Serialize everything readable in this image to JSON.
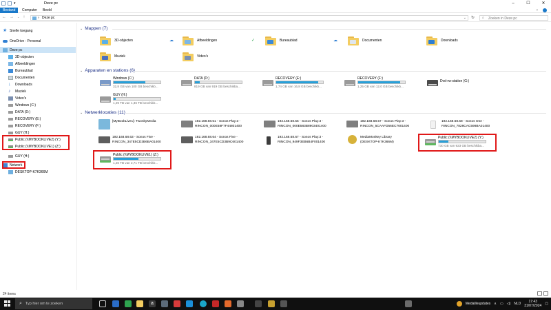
{
  "window": {
    "title": "Deze pc",
    "ribbon_tabs": [
      "Bestand",
      "Computer",
      "Beeld"
    ],
    "address": "Deze pc",
    "search_placeholder": "Zoeken in Deze pc"
  },
  "sidebar": {
    "items": [
      {
        "label": "Snelle toegang",
        "icon": "star-icon"
      },
      {
        "label": "OneDrive - Personal",
        "icon": "cloud-icon"
      },
      {
        "label": "Deze pc",
        "icon": "computer-icon"
      },
      {
        "label": "3D-objecten",
        "icon": "3d-objects-icon"
      },
      {
        "label": "Afbeeldingen",
        "icon": "pictures-icon"
      },
      {
        "label": "Bureaublad",
        "icon": "desktop-icon"
      },
      {
        "label": "Documenten",
        "icon": "documents-icon"
      },
      {
        "label": "Downloads",
        "icon": "downloads-icon"
      },
      {
        "label": "Muziek",
        "icon": "music-icon"
      },
      {
        "label": "Video's",
        "icon": "videos-icon"
      },
      {
        "label": "Windows (C:)",
        "icon": "drive-icon"
      },
      {
        "label": "DATA (D:)",
        "icon": "drive-icon"
      },
      {
        "label": "RECOVERY (E:)",
        "icon": "drive-icon"
      },
      {
        "label": "RECOVERY (F:)",
        "icon": "drive-icon"
      },
      {
        "label": "GUY (H:)",
        "icon": "drive-icon"
      },
      {
        "label": "Public (\\\\MYBOOKLIVE2) (Y:)",
        "icon": "network-drive-icon"
      },
      {
        "label": "Public (\\\\MYBOOKLIVE1) (Z:)",
        "icon": "network-drive-icon"
      },
      {
        "label": "GUY (H:)",
        "icon": "drive-icon"
      },
      {
        "label": "Netwerk",
        "icon": "network-icon"
      },
      {
        "label": "DESKTOP-K7K366M",
        "icon": "computer-icon"
      }
    ]
  },
  "sections": {
    "folders": {
      "title": "Mappen (7)",
      "items": [
        {
          "label": "3D-objecten",
          "badge_color": "#5ab0e8",
          "sync": "cloud"
        },
        {
          "label": "Afbeeldingen",
          "badge_color": "#7cb7e6",
          "sync": "ok"
        },
        {
          "label": "Bureaublad",
          "badge_color": "#3b8ad8",
          "sync": "cloud"
        },
        {
          "label": "Documenten",
          "badge_color": "#dfe6ee",
          "sync": ""
        },
        {
          "label": "Downloads",
          "badge_color": "#2f7fd3",
          "sync": ""
        },
        {
          "label": "Muziek",
          "badge_color": "#4a6fbf",
          "sync": ""
        },
        {
          "label": "Video's",
          "badge_color": "#7a8fb0",
          "sync": ""
        }
      ]
    },
    "drives": {
      "title": "Apparaten en stations (6)",
      "items": [
        {
          "name": "Windows (C:)",
          "free": "32,8 GB van 100 GB beschikb...",
          "used_fraction": 0.67
        },
        {
          "name": "DATA (D:)",
          "free": "819 GB van 919 GB beschikba...",
          "used_fraction": 0.11
        },
        {
          "name": "RECOVERY (E:)",
          "free": "1,74 GB van 16,8 GB beschikb...",
          "used_fraction": 0.9
        },
        {
          "name": "RECOVERY (F:)",
          "free": "1,25 GB van 12,0 GB beschikb...",
          "used_fraction": 0.9
        },
        {
          "name": "Dvd-rw-station (G:)",
          "free": "",
          "used_fraction": null
        },
        {
          "name": "GUY (H:)",
          "free": "1,29 TB van 1,36 TB beschikb...",
          "used_fraction": 0.05
        }
      ]
    },
    "network": {
      "title": "Netwerklocaties (11)",
      "items": [
        {
          "l1": "[MyBookLive1]: TwonkyMedia",
          "l2": "",
          "icon": "twonky-media-icon"
        },
        {
          "l1": "192.168.68.51 - Sonos Play:3 -",
          "l2": "RINCON_000E58F7F448014​00",
          "icon": "sonos-device-icon"
        },
        {
          "l1": "192.168.68.55 - Sonos Play:3 -",
          "l2": "RINCON_000E583B8903401400",
          "icon": "sonos-device-icon"
        },
        {
          "l1": "192.168.68.57 - Sonos Play:3 -",
          "l2": "RINCON_5CAAFD56EC7601400",
          "icon": "sonos-device-icon"
        },
        {
          "l1": "192.168.68.58 - Sonos One -",
          "l2": "RINCON_7828CAC598BA01400",
          "icon": "sonos-one-icon"
        },
        {
          "l1": "192.168.68.63 - Sonos Five -",
          "l2": "RINCON_347E5CD3B6BA01400",
          "icon": "sonos-device-icon"
        },
        {
          "l1": "192.168.68.64 - Sonos Five -",
          "l2": "RINCON_347E5CD3B9C601400",
          "icon": "sonos-device-icon"
        },
        {
          "l1": "192.168.68.67 - Sonos Play:3 -",
          "l2": "RINCON_949F3EB6B4F001400",
          "icon": "sonos-device-icon"
        },
        {
          "l1": "MediaMonkey Library",
          "l2": "(DESKTOP-K7K366M)",
          "icon": "mediamonkey-icon"
        }
      ],
      "drives": [
        {
          "name": "Public (\\\\MYBOOKLIVE2) (Y:)",
          "free": "730 GB van 923 GB beschikba...",
          "used_fraction": 0.21
        },
        {
          "name": "Public (\\\\MYBOOKLIVE1) (Z:)",
          "free": "1,26 TB van 2,71 TB beschikb...",
          "used_fraction": 0.53
        }
      ]
    }
  },
  "status": {
    "items_count": "24 items"
  },
  "taskbar": {
    "search_placeholder": "Typ hier om te zoeken",
    "notification": "Medailleupdates",
    "language": "NLD",
    "time": "17:43",
    "date": "31/07/2024"
  }
}
